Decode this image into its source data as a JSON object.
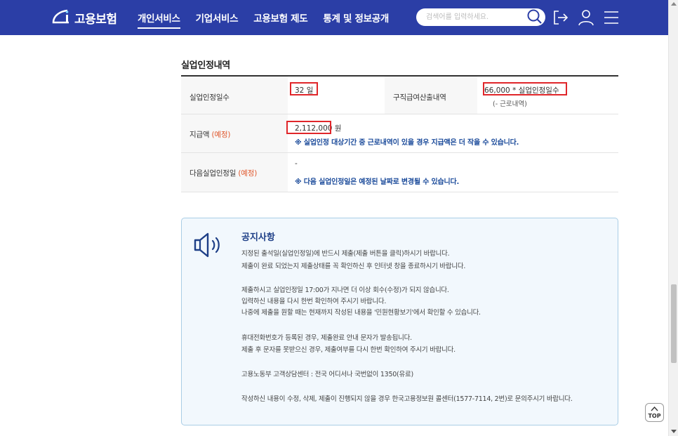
{
  "header": {
    "logo_text": "고용보험",
    "nav": [
      "개인서비스",
      "기업서비스",
      "고용보험 제도",
      "통계 및 정보공개"
    ],
    "search_placeholder": "검색어를 입력하세요."
  },
  "section": {
    "title": "실업인정내역",
    "rows": {
      "days_label": "실업인정일수",
      "days_value": "32 일",
      "calc_label": "구직급여산출내역",
      "calc_value": "66,000 * 실업인정일수",
      "calc_sub": "(- 근로내역)",
      "amount_label": "지급액",
      "amount_expect": "(예정)",
      "amount_value": "2,112,000 원",
      "amount_note": "※ 실업인정 대상기간 중 근로내역이 있을 경우 지급액은 더 작을 수 있습니다.",
      "next_label": "다음실업인정일",
      "next_expect": "(예정)",
      "next_value": "-",
      "next_note": "※ 다음 실업인정일은 예정된 날짜로 변경될 수 있습니다."
    }
  },
  "notice": {
    "title": "공지사항",
    "lines": [
      "지정된 출석일(실업인정일)에 반드시 제출(제출 버튼을 클릭)하시기 바랍니다.",
      "제출이 완료 되었는지 제출상태를 꼭 확인하신 후 인터넷 창을 종료하시기 바랍니다.",
      "제출하시고 실업인정일 17:00가 지나면 더 이상 회수(수정)가 되지 않습니다.",
      "입력하신 내용을 다시 한번 확인하여 주시기 바랍니다.",
      "나중에 제출을 원할 때는 현재까지 작성된 내용을 '민원현황보기'에서 확인할 수 있습니다.",
      "휴대전화번호가 등록된 경우, 제출완료 안내 문자가 발송됩니다.",
      "제출 후 문자를 못받으신 경우, 제출여부를 다시 한번 확인하여 주시기 바랍니다.",
      "고용노동부 고객상담센터 : 전국 어디서나 국번없이 1350(유료)",
      "작성하신 내용이 수정, 삭제, 제출이 진행되지 않을 경우 한국고용정보원 콜센터(1577-7114, 2번)로 문의주시기 바랍니다."
    ]
  },
  "top_button": "TOP",
  "colors": {
    "header_bg": "#2b3ea6",
    "highlight": "#e0262a",
    "expect": "#e0572c",
    "note": "#1a4a9a"
  }
}
